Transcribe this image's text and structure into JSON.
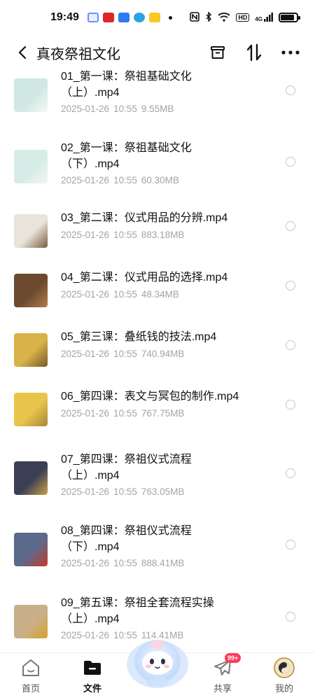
{
  "status_bar": {
    "time": "19:49",
    "network_label": "4G",
    "hd_label": "HD"
  },
  "header": {
    "title": "真夜祭祖文化"
  },
  "files": [
    {
      "name": "01_第一课：祭祖基础文化（上）.mp4",
      "date": "2025-01-26",
      "time": "10:55",
      "size": "9.55MB"
    },
    {
      "name": "02_第一课：祭祖基础文化（下）.mp4",
      "date": "2025-01-26",
      "time": "10:55",
      "size": "60.30MB"
    },
    {
      "name": "03_第二课：仪式用品的分辨.mp4",
      "date": "2025-01-26",
      "time": "10:55",
      "size": "883.18MB"
    },
    {
      "name": "04_第二课：仪式用品的选择.mp4",
      "date": "2025-01-26",
      "time": "10:55",
      "size": "48.34MB"
    },
    {
      "name": "05_第三课：叠纸钱的技法.mp4",
      "date": "2025-01-26",
      "time": "10:55",
      "size": "740.94MB"
    },
    {
      "name": "06_第四课：表文与冥包的制作.mp4",
      "date": "2025-01-26",
      "time": "10:55",
      "size": "767.75MB"
    },
    {
      "name": "07_第四课：祭祖仪式流程（上）.mp4",
      "date": "2025-01-26",
      "time": "10:55",
      "size": "763.05MB"
    },
    {
      "name": "08_第四课：祭祖仪式流程（下）.mp4",
      "date": "2025-01-26",
      "time": "10:55",
      "size": "888.41MB"
    },
    {
      "name": "09_第五课：祭祖全套流程实操（上）.mp4",
      "date": "2025-01-26",
      "time": "10:55",
      "size": "114.41MB"
    }
  ],
  "nav": {
    "home": "首页",
    "files": "文件",
    "share": "共享",
    "share_badge": "99+",
    "mine": "我的"
  }
}
